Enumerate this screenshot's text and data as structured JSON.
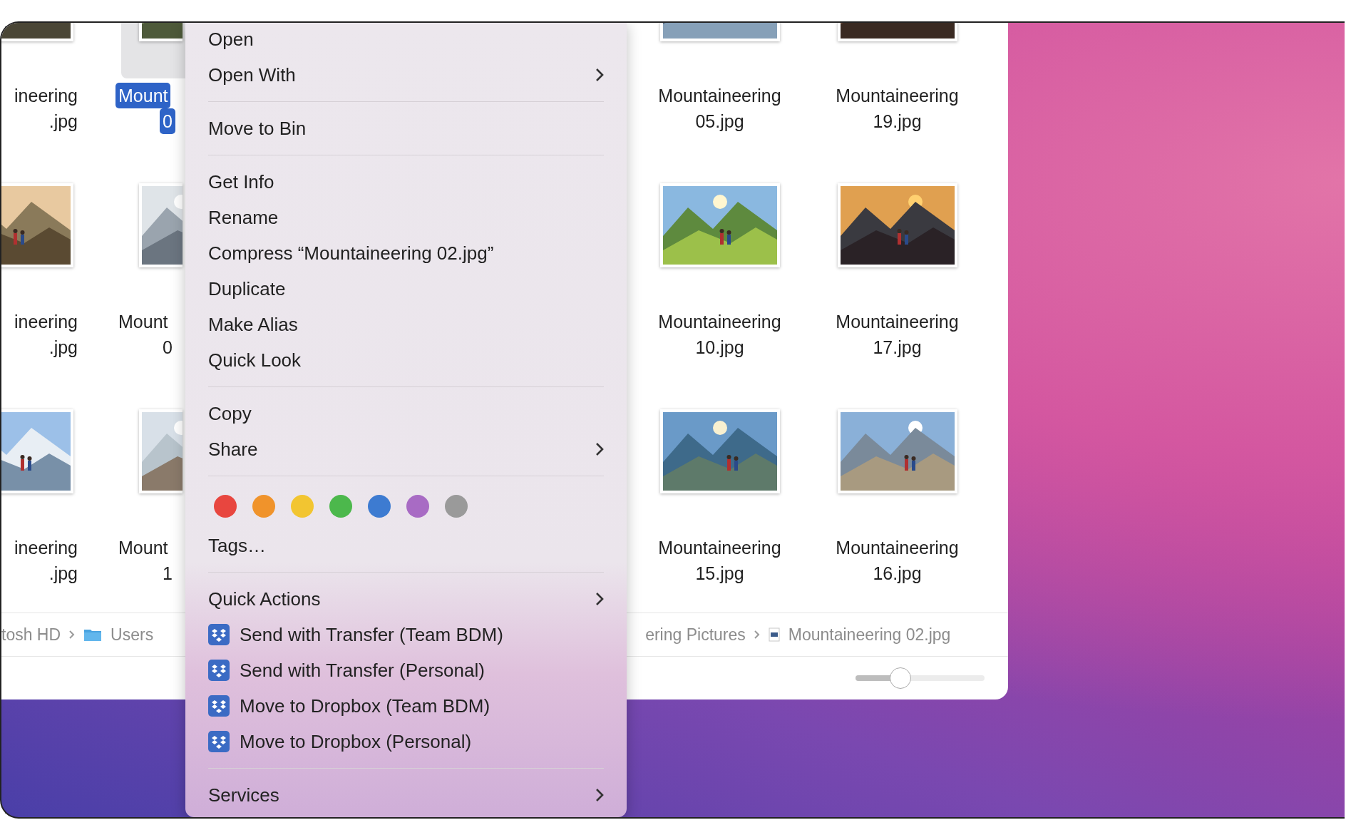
{
  "icon_grid": {
    "rows": [
      [
        {
          "label_lines": [
            "ineering",
            ".jpg"
          ],
          "selected": false
        },
        {
          "label_lines": [
            "Mount",
            "0"
          ],
          "selected": true
        },
        {
          "label_lines": [
            "Mountaineering",
            "05.jpg"
          ],
          "selected": false
        },
        {
          "label_lines": [
            "Mountaineering",
            "19.jpg"
          ],
          "selected": false
        }
      ],
      [
        {
          "label_lines": [
            "ineering",
            ".jpg"
          ],
          "selected": false
        },
        {
          "label_lines": [
            "Mount",
            "0"
          ],
          "selected": false
        },
        {
          "label_lines": [
            "Mountaineering",
            "10.jpg"
          ],
          "selected": false
        },
        {
          "label_lines": [
            "Mountaineering",
            "17.jpg"
          ],
          "selected": false
        }
      ],
      [
        {
          "label_lines": [
            "ineering",
            ".jpg"
          ],
          "selected": false
        },
        {
          "label_lines": [
            "Mount",
            "1"
          ],
          "selected": false
        },
        {
          "label_lines": [
            "Mountaineering",
            "15.jpg"
          ],
          "selected": false
        },
        {
          "label_lines": [
            "Mountaineering",
            "16.jpg"
          ],
          "selected": false
        }
      ]
    ]
  },
  "path_bar": {
    "left": [
      {
        "text": "tosh HD"
      },
      {
        "text": "Users"
      }
    ],
    "right": [
      {
        "text": "ering Pictures"
      },
      {
        "text": "Mountaineering 02.jpg"
      }
    ]
  },
  "zoom_slider": {
    "level": 0.35
  },
  "context_menu": {
    "items": [
      {
        "kind": "command",
        "label": "Open",
        "submenu": false
      },
      {
        "kind": "command",
        "label": "Open With",
        "submenu": true
      },
      {
        "kind": "separator"
      },
      {
        "kind": "command",
        "label": "Move to Bin",
        "submenu": false
      },
      {
        "kind": "separator"
      },
      {
        "kind": "command",
        "label": "Get Info",
        "submenu": false
      },
      {
        "kind": "command",
        "label": "Rename",
        "submenu": false
      },
      {
        "kind": "command",
        "label": "Compress “Mountaineering 02.jpg”",
        "submenu": false
      },
      {
        "kind": "command",
        "label": "Duplicate",
        "submenu": false
      },
      {
        "kind": "command",
        "label": "Make Alias",
        "submenu": false
      },
      {
        "kind": "command",
        "label": "Quick Look",
        "submenu": false
      },
      {
        "kind": "separator"
      },
      {
        "kind": "command",
        "label": "Copy",
        "submenu": false
      },
      {
        "kind": "command",
        "label": "Share",
        "submenu": true
      },
      {
        "kind": "separator"
      },
      {
        "kind": "color_tags",
        "colors": [
          {
            "color": "#e8463f"
          },
          {
            "color": "#f0932b"
          },
          {
            "color": "#f2c531"
          },
          {
            "color": "#4cb84c"
          },
          {
            "color": "#3d7bd1"
          },
          {
            "color": "#a86bc4"
          },
          {
            "color": "#9a9a9a"
          }
        ]
      },
      {
        "kind": "command",
        "label": "Tags…",
        "submenu": false
      },
      {
        "kind": "separator"
      },
      {
        "kind": "command",
        "label": "Quick Actions",
        "submenu": true
      },
      {
        "kind": "quick_action",
        "label": "Send with Transfer (Team BDM)"
      },
      {
        "kind": "quick_action",
        "label": "Send with Transfer (Personal)"
      },
      {
        "kind": "quick_action",
        "label": "Move to Dropbox (Team BDM)"
      },
      {
        "kind": "quick_action",
        "label": "Move to Dropbox (Personal)"
      },
      {
        "kind": "separator"
      },
      {
        "kind": "command",
        "label": "Services",
        "submenu": true
      }
    ]
  }
}
